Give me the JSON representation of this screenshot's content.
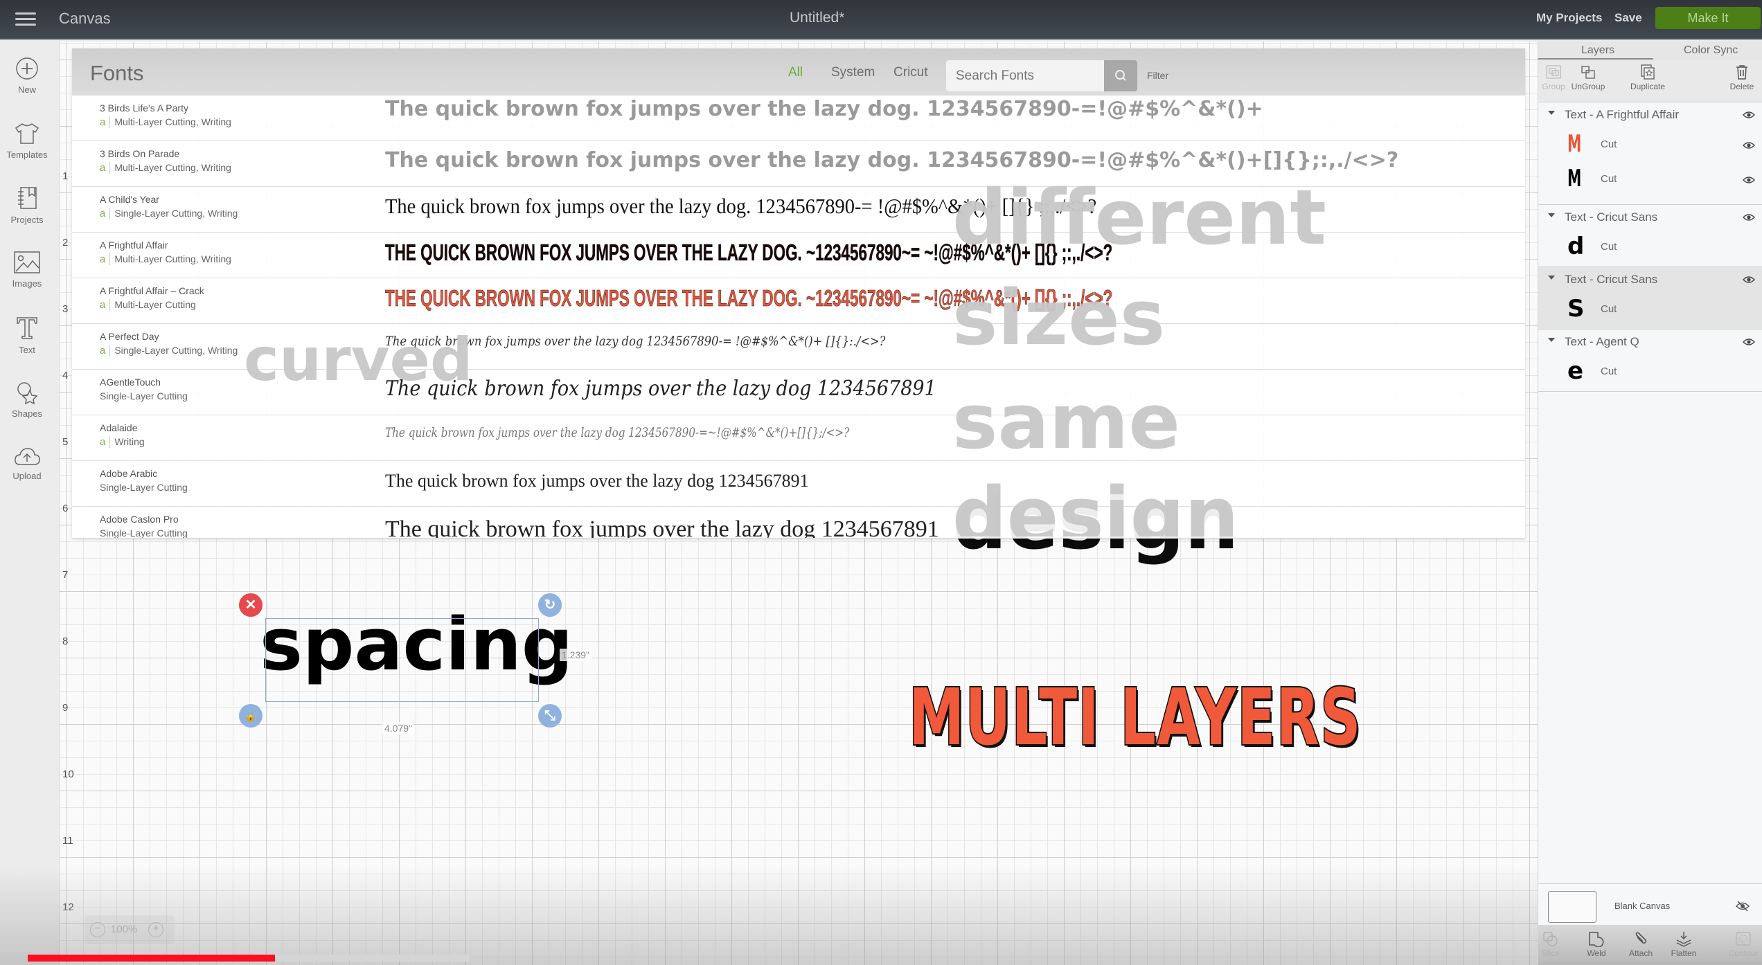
{
  "topbar": {
    "app_name": "Canvas",
    "doc_title": "Untitled*",
    "my_projects": "My Projects",
    "save": "Save",
    "make_it": "Make It"
  },
  "leftbar": {
    "items": [
      {
        "label": "New",
        "icon": "plus-circle-icon"
      },
      {
        "label": "Templates",
        "icon": "shirt-icon"
      },
      {
        "label": "Projects",
        "icon": "notebook-icon"
      },
      {
        "label": "Images",
        "icon": "image-icon"
      },
      {
        "label": "Text",
        "icon": "text-t-icon"
      },
      {
        "label": "Shapes",
        "icon": "shapes-icon"
      },
      {
        "label": "Upload",
        "icon": "cloud-upload-icon"
      }
    ]
  },
  "ruler": {
    "vertical": [
      "1",
      "2",
      "3",
      "4",
      "5",
      "6",
      "7",
      "8",
      "9",
      "10",
      "11",
      "12"
    ]
  },
  "fonts_panel": {
    "title": "Fonts",
    "tabs": [
      {
        "label": "All",
        "active": true
      },
      {
        "label": "System",
        "active": false
      },
      {
        "label": "Cricut",
        "active": false
      }
    ],
    "search_placeholder": "Search Fonts",
    "filter_label": "Filter",
    "rows": [
      {
        "name": "3 Birds Life's A Party",
        "meta": "Multi-Layer Cutting, Writing",
        "cricut": true,
        "sample": "The quick brown fox jumps over the lazy dog. 1234567890-=!@#$%^&*()+",
        "color": "#9a9a9a"
      },
      {
        "name": "3 Birds On Parade",
        "meta": "Multi-Layer Cutting, Writing",
        "cricut": true,
        "sample": "The quick brown fox jumps over the lazy dog. 1234567890-=!@#$%^&*()+[]{};:,./<>?",
        "color": "#9a9a9a"
      },
      {
        "name": "A Child's Year",
        "meta": "Single-Layer Cutting, Writing",
        "cricut": true,
        "sample": "The quick brown fox jumps over the lazy dog. 1234567890-= !@#$%^&*()+ []{} ;:,./<>?",
        "color": "#111111"
      },
      {
        "name": "A Frightful Affair",
        "meta": "Multi-Layer Cutting, Writing",
        "cricut": true,
        "sample": "THE QUICK BROWN FOX JUMPS OVER THE LAZY DOG. ~1234567890~= ~!@#$%^&*()+ []{} ;:,./<>?",
        "color": "#1a0a08"
      },
      {
        "name": "A Frightful Affair – Crack",
        "meta": "Multi-Layer Cutting",
        "cricut": true,
        "sample": "THE QUICK BROWN FOX JUMPS OVER THE LAZY DOG. ~1234567890~= ~!@#$%^&*()+ []{} ;:,./<>?",
        "color": "#e2553a"
      },
      {
        "name": "A Perfect Day",
        "meta": "Single-Layer Cutting, Writing",
        "cricut": true,
        "sample": "The quick brown fox jumps over the lazy dog 1234567890-= !@#$%^&*()+ []{}:./<>?",
        "color": "#333333"
      },
      {
        "name": "AGentleTouch",
        "meta": "Single-Layer Cutting",
        "cricut": false,
        "sample": "The quick brown fox jumps over the lazy dog 1234567891",
        "color": "#222222"
      },
      {
        "name": "Adalaide",
        "meta": "Writing",
        "cricut": true,
        "sample": "The quick brown fox jumps over the lazy dog 1234567890-=~!@#$%^&*()+[]{};/<>?",
        "color": "#777777"
      },
      {
        "name": "Adobe Arabic",
        "meta": "Single-Layer Cutting",
        "cricut": false,
        "sample": "The quick brown fox jumps over the lazy dog 1234567891",
        "color": "#222222"
      },
      {
        "name": "Adobe Caslon Pro",
        "meta": "Single-Layer Cutting",
        "cricut": false,
        "sample": "The quick brown fox jumps over the lazy dog 1234567891",
        "color": "#222222"
      }
    ]
  },
  "overlay_words": {
    "curved": "curved",
    "different": "different",
    "sizes": "sizes",
    "same": "same",
    "design": "design"
  },
  "canvas": {
    "selected_text": "spacing",
    "width_readout": "4.079\"",
    "height_readout": "1.239\"",
    "multi_text": "MULTI LAYERS",
    "zoom_level": "100%",
    "zoom_minus": "−",
    "zoom_plus": "+"
  },
  "layers_panel": {
    "tabs": [
      {
        "label": "Layers",
        "active": true
      },
      {
        "label": "Color Sync",
        "active": false
      }
    ],
    "tools": [
      {
        "label": "Group",
        "enabled": false
      },
      {
        "label": "UnGroup",
        "enabled": true
      },
      {
        "label": "Duplicate",
        "enabled": true
      },
      {
        "label": "Delete",
        "enabled": true
      }
    ],
    "groups": [
      {
        "label": "Text - A Frightful Affair",
        "children": [
          {
            "glyph": "M",
            "color": "#e8553a",
            "op": "Cut"
          },
          {
            "glyph": "M",
            "color": "#000000",
            "op": "Cut"
          }
        ]
      },
      {
        "label": "Text - Cricut Sans",
        "children": [
          {
            "glyph": "d",
            "color": "#000000",
            "op": "Cut"
          }
        ]
      },
      {
        "label": "Text - Cricut Sans",
        "selected": true,
        "children": [
          {
            "glyph": "S",
            "color": "#000000",
            "op": "Cut"
          }
        ]
      },
      {
        "label": "Text - Agent Q",
        "children": [
          {
            "glyph": "e",
            "color": "#000000",
            "op": "Cut"
          }
        ]
      }
    ],
    "blank_canvas": "Blank Canvas",
    "bottom_tools": [
      {
        "label": "Slice",
        "enabled": false
      },
      {
        "label": "Weld",
        "enabled": true
      },
      {
        "label": "Attach",
        "enabled": true
      },
      {
        "label": "Flatten",
        "enabled": true
      },
      {
        "label": "Contour",
        "enabled": false
      }
    ]
  },
  "video_progress": {
    "played_fraction": 0.56,
    "buffered_fraction": 0.62,
    "color": "#ff0d1e"
  }
}
